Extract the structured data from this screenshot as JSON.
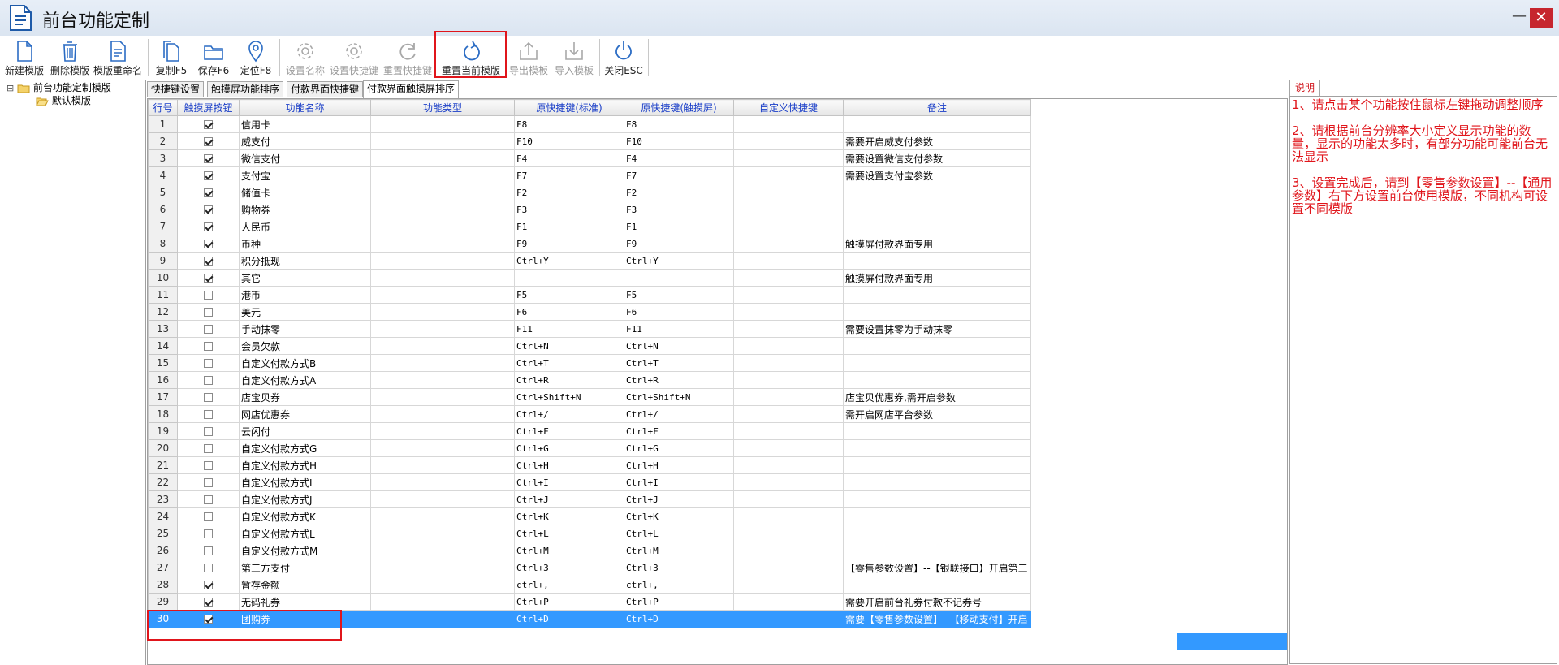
{
  "window": {
    "title": "前台功能定制",
    "minimize_glyph": "—",
    "close_glyph": "✕"
  },
  "toolbar": {
    "buttons": [
      {
        "label": "新建模版",
        "icon": "new-document-icon",
        "enabled": true
      },
      {
        "label": "删除模版",
        "icon": "trash-icon",
        "enabled": true
      },
      {
        "label": "模版重命名",
        "icon": "document-rename-icon",
        "enabled": true
      },
      {
        "label": "复制F5",
        "icon": "copy-icon",
        "enabled": true
      },
      {
        "label": "保存F6",
        "icon": "folder-icon",
        "enabled": true
      },
      {
        "label": "定位F8",
        "icon": "location-pin-icon",
        "enabled": true
      },
      {
        "label": "设置名称",
        "icon": "gear-icon",
        "enabled": false
      },
      {
        "label": "设置快捷键",
        "icon": "gear-icon",
        "enabled": false
      },
      {
        "label": "重置快捷键",
        "icon": "refresh-icon",
        "enabled": false
      },
      {
        "label": "重置当前模版",
        "icon": "reset-icon",
        "enabled": true
      },
      {
        "label": "导出模板",
        "icon": "export-icon",
        "enabled": false
      },
      {
        "label": "导入模板",
        "icon": "import-icon",
        "enabled": false
      },
      {
        "label": "关闭ESC",
        "icon": "power-icon",
        "enabled": true
      }
    ]
  },
  "tree": {
    "root": "前台功能定制模版",
    "children": [
      "默认模版"
    ],
    "expander": "⊟"
  },
  "tabs": [
    {
      "label": "快捷键设置",
      "active": false
    },
    {
      "label": "触摸屏功能排序",
      "active": false
    },
    {
      "label": "付款界面快捷键",
      "active": false
    },
    {
      "label": "付款界面触摸屏排序",
      "active": true
    }
  ],
  "grid": {
    "columns": [
      "行号",
      "触摸屏按钮",
      "功能名称",
      "功能类型",
      "原快捷键(标准)",
      "原快捷键(触摸屏)",
      "自定义快捷键",
      "备注"
    ],
    "selected_row": 30,
    "rows": [
      {
        "no": "1",
        "checked": true,
        "name": "信用卡",
        "type": "",
        "std": "F8",
        "touch": "F8",
        "custom": "",
        "note": ""
      },
      {
        "no": "2",
        "checked": true,
        "name": "威支付",
        "type": "",
        "std": "F10",
        "touch": "F10",
        "custom": "",
        "note": "需要开启威支付参数"
      },
      {
        "no": "3",
        "checked": true,
        "name": "微信支付",
        "type": "",
        "std": "F4",
        "touch": "F4",
        "custom": "",
        "note": "需要设置微信支付参数"
      },
      {
        "no": "4",
        "checked": true,
        "name": "支付宝",
        "type": "",
        "std": "F7",
        "touch": "F7",
        "custom": "",
        "note": "需要设置支付宝参数"
      },
      {
        "no": "5",
        "checked": true,
        "name": "储值卡",
        "type": "",
        "std": "F2",
        "touch": "F2",
        "custom": "",
        "note": ""
      },
      {
        "no": "6",
        "checked": true,
        "name": "购物券",
        "type": "",
        "std": "F3",
        "touch": "F3",
        "custom": "",
        "note": ""
      },
      {
        "no": "7",
        "checked": true,
        "name": "人民币",
        "type": "",
        "std": "F1",
        "touch": "F1",
        "custom": "",
        "note": ""
      },
      {
        "no": "8",
        "checked": true,
        "name": "币种",
        "type": "",
        "std": "F9",
        "touch": "F9",
        "custom": "",
        "note": "触摸屏付款界面专用"
      },
      {
        "no": "9",
        "checked": true,
        "name": "积分抵现",
        "type": "",
        "std": "Ctrl+Y",
        "touch": "Ctrl+Y",
        "custom": "",
        "note": ""
      },
      {
        "no": "10",
        "checked": true,
        "name": "其它",
        "type": "",
        "std": "",
        "touch": "",
        "custom": "",
        "note": "触摸屏付款界面专用"
      },
      {
        "no": "11",
        "checked": false,
        "name": "港币",
        "type": "",
        "std": "F5",
        "touch": "F5",
        "custom": "",
        "note": ""
      },
      {
        "no": "12",
        "checked": false,
        "name": "美元",
        "type": "",
        "std": "F6",
        "touch": "F6",
        "custom": "",
        "note": ""
      },
      {
        "no": "13",
        "checked": false,
        "name": "手动抹零",
        "type": "",
        "std": "F11",
        "touch": "F11",
        "custom": "",
        "note": "需要设置抹零为手动抹零"
      },
      {
        "no": "14",
        "checked": false,
        "name": "会员欠款",
        "type": "",
        "std": "Ctrl+N",
        "touch": "Ctrl+N",
        "custom": "",
        "note": ""
      },
      {
        "no": "15",
        "checked": false,
        "name": "自定义付款方式B",
        "type": "",
        "std": "Ctrl+T",
        "touch": "Ctrl+T",
        "custom": "",
        "note": ""
      },
      {
        "no": "16",
        "checked": false,
        "name": "自定义付款方式A",
        "type": "",
        "std": "Ctrl+R",
        "touch": "Ctrl+R",
        "custom": "",
        "note": ""
      },
      {
        "no": "17",
        "checked": false,
        "name": "店宝贝券",
        "type": "",
        "std": "Ctrl+Shift+N",
        "touch": "Ctrl+Shift+N",
        "custom": "",
        "note": "店宝贝优惠券,需开启参数"
      },
      {
        "no": "18",
        "checked": false,
        "name": "网店优惠券",
        "type": "",
        "std": "Ctrl+/",
        "touch": "Ctrl+/",
        "custom": "",
        "note": "需开启网店平台参数"
      },
      {
        "no": "19",
        "checked": false,
        "name": "云闪付",
        "type": "",
        "std": "Ctrl+F",
        "touch": "Ctrl+F",
        "custom": "",
        "note": ""
      },
      {
        "no": "20",
        "checked": false,
        "name": "自定义付款方式G",
        "type": "",
        "std": "Ctrl+G",
        "touch": "Ctrl+G",
        "custom": "",
        "note": ""
      },
      {
        "no": "21",
        "checked": false,
        "name": "自定义付款方式H",
        "type": "",
        "std": "Ctrl+H",
        "touch": "Ctrl+H",
        "custom": "",
        "note": ""
      },
      {
        "no": "22",
        "checked": false,
        "name": "自定义付款方式I",
        "type": "",
        "std": "Ctrl+I",
        "touch": "Ctrl+I",
        "custom": "",
        "note": ""
      },
      {
        "no": "23",
        "checked": false,
        "name": "自定义付款方式J",
        "type": "",
        "std": "Ctrl+J",
        "touch": "Ctrl+J",
        "custom": "",
        "note": ""
      },
      {
        "no": "24",
        "checked": false,
        "name": "自定义付款方式K",
        "type": "",
        "std": "Ctrl+K",
        "touch": "Ctrl+K",
        "custom": "",
        "note": ""
      },
      {
        "no": "25",
        "checked": false,
        "name": "自定义付款方式L",
        "type": "",
        "std": "Ctrl+L",
        "touch": "Ctrl+L",
        "custom": "",
        "note": ""
      },
      {
        "no": "26",
        "checked": false,
        "name": "自定义付款方式M",
        "type": "",
        "std": "Ctrl+M",
        "touch": "Ctrl+M",
        "custom": "",
        "note": ""
      },
      {
        "no": "27",
        "checked": false,
        "name": "第三方支付",
        "type": "",
        "std": "Ctrl+3",
        "touch": "Ctrl+3",
        "custom": "",
        "note": "【零售参数设置】--【银联接口】开启第三"
      },
      {
        "no": "28",
        "checked": true,
        "name": "暂存金额",
        "type": "",
        "std": "ctrl+,",
        "touch": "ctrl+,",
        "custom": "",
        "note": ""
      },
      {
        "no": "29",
        "checked": true,
        "name": "无码礼券",
        "type": "",
        "std": "Ctrl+P",
        "touch": "Ctrl+P",
        "custom": "",
        "note": "需要开启前台礼券付款不记券号"
      },
      {
        "no": "30",
        "checked": true,
        "name": "团购券",
        "type": "",
        "std": "Ctrl+D",
        "touch": "Ctrl+D",
        "custom": "",
        "note": "需要【零售参数设置】--【移动支付】开启"
      }
    ]
  },
  "help": {
    "tab_label": "说明",
    "paragraphs": [
      "1、请点击某个功能按住鼠标左键拖动调整顺序",
      "2、请根据前台分辨率大小定义显示功能的数量，显示的功能太多时，有部分功能可能前台无法显示",
      "3、设置完成后，请到【零售参数设置】--【通用参数】右下方设置前台使用模版，不同机构可设置不同模版"
    ]
  },
  "colors": {
    "highlight_box": "#e0151b",
    "selected_row": "#3399ff",
    "help_text": "#e0151b",
    "header_text": "#1a3ec8"
  }
}
